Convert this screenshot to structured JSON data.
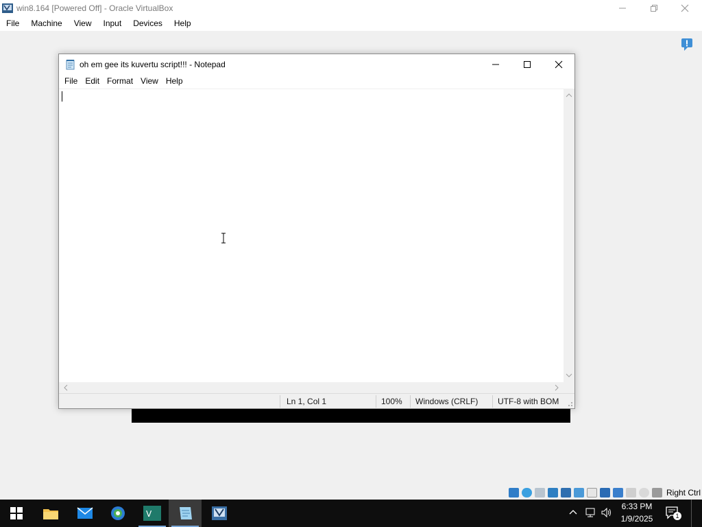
{
  "vbox": {
    "title": "win8.164 [Powered Off] - Oracle VirtualBox",
    "menu": [
      "File",
      "Machine",
      "View",
      "Input",
      "Devices",
      "Help"
    ],
    "host_key": "Right Ctrl",
    "status_icons": [
      "hard-disk",
      "optical-drive",
      "floppy",
      "audio",
      "network",
      "usb",
      "shared-folders",
      "display",
      "video-capture",
      "recording",
      "cpu",
      "mouse-integration",
      "keyboard"
    ]
  },
  "notepad": {
    "title": "oh em gee its kuvertu script!!! - Notepad",
    "menu": [
      "File",
      "Edit",
      "Format",
      "View",
      "Help"
    ],
    "content": "",
    "status": {
      "position": "Ln 1, Col 1",
      "zoom": "100%",
      "line_ending": "Windows (CRLF)",
      "encoding": "UTF-8 with BOM"
    }
  },
  "taskbar": {
    "apps": [
      "start",
      "file-explorer",
      "mail",
      "browser",
      "visual-studio",
      "notepad",
      "virtualbox"
    ],
    "active_app": "notepad",
    "time": "6:33 PM",
    "date": "1/9/2025",
    "notification_count": "1"
  },
  "colors": {
    "taskbar": "#0e0e0e",
    "window_bg": "#ffffff",
    "chrome_bg": "#f0f0f0",
    "accent": "#0078d7"
  }
}
